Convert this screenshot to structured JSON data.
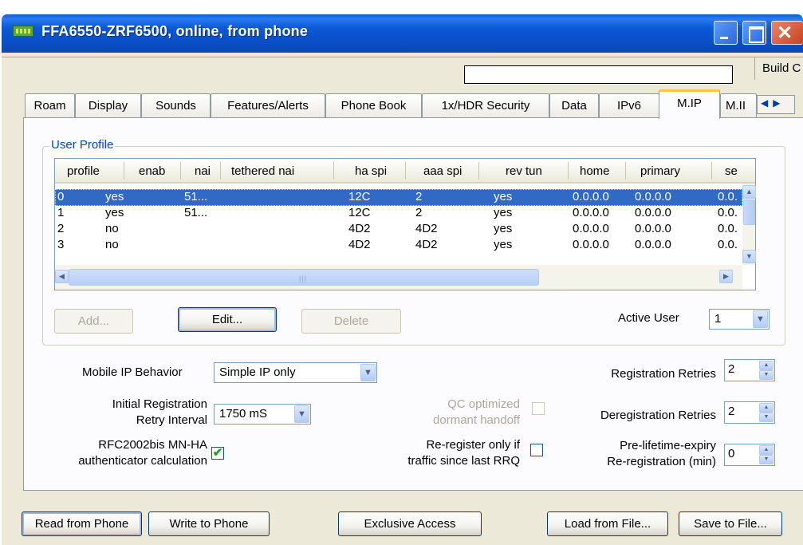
{
  "window": {
    "title": "FFA6550-ZRF6500, online, from phone"
  },
  "status_bar": {
    "build_label": "Build C"
  },
  "tabs": [
    {
      "label": "Roam"
    },
    {
      "label": "Display"
    },
    {
      "label": "Sounds"
    },
    {
      "label": "Features/Alerts"
    },
    {
      "label": "Phone Book"
    },
    {
      "label": "1x/HDR Security"
    },
    {
      "label": "Data"
    },
    {
      "label": "IPv6"
    },
    {
      "label": "M.IP"
    },
    {
      "label": "M.II"
    }
  ],
  "active_tab": "M.IP",
  "user_profile": {
    "group_label": "User Profile",
    "columns": [
      "profile",
      "enab",
      "nai",
      "tethered nai",
      "ha spi",
      "aaa spi",
      "rev tun",
      "home",
      "primary",
      "se"
    ],
    "rows": [
      [
        "0",
        "yes",
        "51...",
        "",
        "12C",
        "2",
        "yes",
        "0.0.0.0",
        "0.0.0.0",
        "0.0."
      ],
      [
        "1",
        "yes",
        "51...",
        "",
        "12C",
        "2",
        "yes",
        "0.0.0.0",
        "0.0.0.0",
        "0.0."
      ],
      [
        "2",
        "no",
        "",
        "",
        "4D2",
        "4D2",
        "yes",
        "0.0.0.0",
        "0.0.0.0",
        "0.0."
      ],
      [
        "3",
        "no",
        "",
        "",
        "4D2",
        "4D2",
        "yes",
        "0.0.0.0",
        "0.0.0.0",
        "0.0."
      ]
    ],
    "selected_row": 0,
    "add_label": "Add...",
    "edit_label": "Edit...",
    "delete_label": "Delete",
    "active_user_label": "Active User",
    "active_user_value": "1"
  },
  "settings": {
    "mobile_ip_behavior_label": "Mobile IP Behavior",
    "mobile_ip_behavior_value": "Simple IP only",
    "initial_reg_label_1": "Initial Registration",
    "initial_reg_label_2": "Retry Interval",
    "initial_reg_value": "1750 mS",
    "rfc_label_1": "RFC2002bis MN-HA",
    "rfc_label_2": "authenticator calculation",
    "rfc_checked": "✔",
    "qc_label_1": "QC optimized",
    "qc_label_2": "dormant handoff",
    "rereg_label_1": "Re-register only if",
    "rereg_label_2": "traffic since last RRQ",
    "reg_retries_label": "Registration Retries",
    "reg_retries_value": "2",
    "dereg_retries_label": "Deregistration Retries",
    "dereg_retries_value": "2",
    "prelife_label_1": "Pre-lifetime-expiry",
    "prelife_label_2": "Re-registration (min)",
    "prelife_value": "0"
  },
  "bottom_buttons": {
    "read": "Read from Phone",
    "write": "Write to Phone",
    "exclusive": "Exclusive Access",
    "load": "Load from File...",
    "save": "Save to File..."
  },
  "icons": {
    "app": "phone-app-icon",
    "minimize": "minimize-icon",
    "maximize": "maximize-icon",
    "close": "close-icon"
  },
  "colors": {
    "titlebar": "#0a4fc8",
    "selection": "#316ac5",
    "window_face": "#ece9d8",
    "group_label": "#0046d5"
  }
}
